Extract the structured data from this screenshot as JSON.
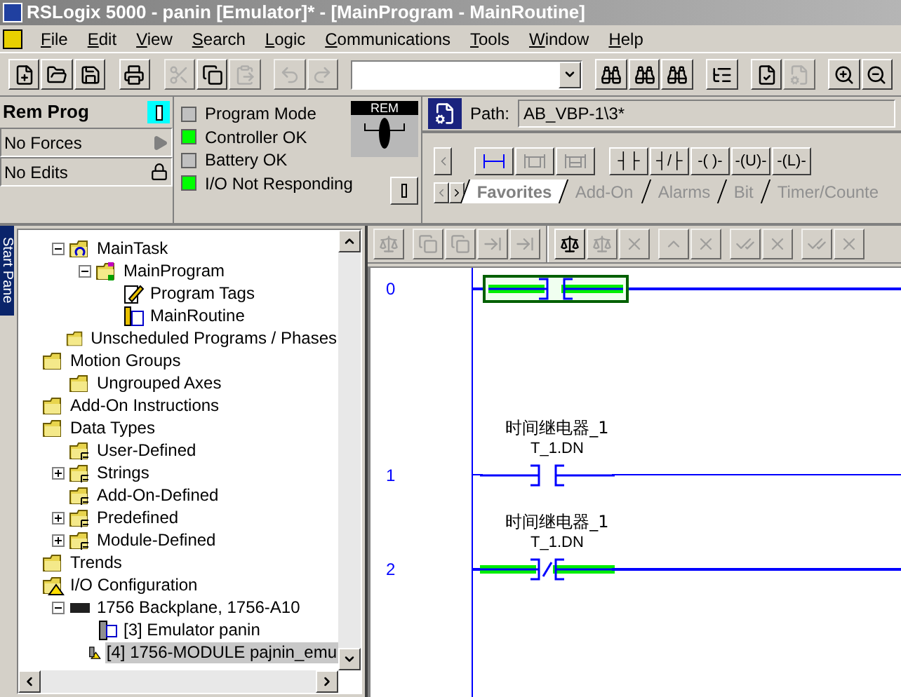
{
  "window": {
    "title": "RSLogix 5000 - panin [Emulator]* - [MainProgram - MainRoutine]"
  },
  "menu": [
    "File",
    "Edit",
    "View",
    "Search",
    "Logic",
    "Communications",
    "Tools",
    "Window",
    "Help"
  ],
  "toolbar": [
    [
      {
        "kind": "new",
        "disabled": false
      },
      {
        "kind": "open",
        "disabled": false
      },
      {
        "kind": "save",
        "disabled": false
      }
    ],
    [
      {
        "kind": "print",
        "disabled": false
      }
    ],
    [
      {
        "kind": "cut",
        "disabled": true
      },
      {
        "kind": "copy",
        "disabled": false
      },
      {
        "kind": "paste",
        "disabled": true
      }
    ],
    [
      {
        "kind": "undo",
        "disabled": true
      },
      {
        "kind": "redo",
        "disabled": true
      }
    ],
    [
      {
        "kind": "find",
        "disabled": false
      },
      {
        "kind": "find-prev",
        "disabled": false
      },
      {
        "kind": "find-folder",
        "disabled": false
      }
    ],
    [
      {
        "kind": "tree",
        "disabled": false
      }
    ],
    [
      {
        "kind": "verify",
        "disabled": false
      },
      {
        "kind": "verify-all",
        "disabled": true
      }
    ],
    [
      {
        "kind": "zoom-in",
        "disabled": false
      },
      {
        "kind": "zoom-out",
        "disabled": false
      }
    ]
  ],
  "controller": {
    "mode": "Rem Prog",
    "forces": "No Forces",
    "edits": "No Edits",
    "key_label": "REM"
  },
  "lights": [
    {
      "label": "Program Mode",
      "on": false
    },
    {
      "label": "Controller OK",
      "on": true
    },
    {
      "label": "Battery OK",
      "on": false
    },
    {
      "label": "I/O Not Responding",
      "on": true
    }
  ],
  "path": {
    "label": "Path:",
    "value": "AB_VBP-1\\3*"
  },
  "palette": [
    {
      "kind": "rung",
      "disabled": false
    },
    {
      "kind": "branch",
      "disabled": true
    },
    {
      "kind": "branch-level",
      "disabled": true
    },
    {
      "kind": "text",
      "label": "┤├",
      "disabled": false
    },
    {
      "kind": "text",
      "label": "┤/├",
      "disabled": false
    },
    {
      "kind": "text",
      "label": "-( )-",
      "disabled": false
    },
    {
      "kind": "text",
      "label": "-(U)-",
      "disabled": false
    },
    {
      "kind": "text",
      "label": "-(L)-",
      "disabled": false
    }
  ],
  "palette_tabs": [
    {
      "label": "Favorites",
      "selected": true
    },
    {
      "label": "Add-On",
      "selected": false
    },
    {
      "label": "Alarms",
      "selected": false
    },
    {
      "label": "Bit",
      "selected": false
    },
    {
      "label": "Timer/Counte",
      "selected": false
    }
  ],
  "start_pane": {
    "label": "Start Pane"
  },
  "tree": {
    "continued_items": [
      {
        "label": "MainTask",
        "kind": "task",
        "expanded": true,
        "selected": false,
        "children": [
          {
            "label": "MainProgram",
            "kind": "program",
            "expanded": true,
            "selected": false,
            "children": [
              {
                "label": "Program Tags",
                "kind": "tags",
                "selected": false
              },
              {
                "label": "MainRoutine",
                "kind": "routine",
                "selected": false
              }
            ]
          }
        ]
      },
      {
        "label": "Unscheduled Programs / Phases",
        "kind": "folder",
        "selected": false
      }
    ],
    "items": [
      {
        "label": "Motion Groups",
        "kind": "folder",
        "selected": false,
        "children": [
          {
            "label": "Ungrouped Axes",
            "kind": "folder",
            "selected": false
          }
        ]
      },
      {
        "label": "Add-On Instructions",
        "kind": "folder",
        "selected": false
      },
      {
        "label": "Data Types",
        "kind": "folder",
        "selected": false,
        "children": [
          {
            "label": "User-Defined",
            "kind": "data-folder",
            "selected": false
          },
          {
            "label": "Strings",
            "kind": "data-folder",
            "expanded": false,
            "selected": false
          },
          {
            "label": "Add-On-Defined",
            "kind": "data-folder",
            "selected": false
          },
          {
            "label": "Predefined",
            "kind": "data-folder",
            "expanded": false,
            "selected": false
          },
          {
            "label": "Module-Defined",
            "kind": "data-folder",
            "expanded": false,
            "selected": false
          }
        ]
      },
      {
        "label": "Trends",
        "kind": "folder",
        "selected": false
      },
      {
        "label": "I/O Configuration",
        "kind": "warning-folder",
        "selected": false,
        "children": [
          {
            "label": "1756 Backplane, 1756-A10",
            "kind": "backplane",
            "expanded": true,
            "selected": false,
            "children": [
              {
                "label": "[3] Emulator panin",
                "kind": "module",
                "selected": false
              },
              {
                "label": "[4] 1756-MODULE pajnin_emu",
                "kind": "warning-module",
                "selected": true
              }
            ]
          }
        ]
      }
    ]
  },
  "ladder_toolbar": [
    [
      {
        "kind": "a",
        "disabled": true
      }
    ],
    [
      {
        "kind": "b",
        "disabled": true
      },
      {
        "kind": "b",
        "disabled": true
      },
      {
        "kind": "c",
        "disabled": true
      },
      {
        "kind": "c",
        "disabled": true
      }
    ],
    [
      {
        "kind": "e",
        "disabled": false
      },
      {
        "kind": "e",
        "disabled": true
      },
      {
        "kind": "x",
        "disabled": true
      }
    ],
    [
      {
        "kind": "i",
        "disabled": true
      },
      {
        "kind": "x",
        "disabled": true
      }
    ],
    [
      {
        "kind": "check",
        "disabled": true
      },
      {
        "kind": "x",
        "disabled": true
      }
    ],
    [
      {
        "kind": "check",
        "disabled": true
      },
      {
        "kind": "x",
        "disabled": true
      }
    ]
  ],
  "rungs": [
    {
      "number": "0",
      "kind": "xic",
      "energized": true,
      "selected": true
    },
    {
      "number": "1",
      "description": "时间继电器_1",
      "tag": "T_1.DN",
      "kind": "xic",
      "energized": false,
      "selected": false
    },
    {
      "number": "2",
      "description": "时间继电器_1",
      "tag": "T_1.DN",
      "kind": "xio",
      "energized": true,
      "selected": false
    }
  ]
}
